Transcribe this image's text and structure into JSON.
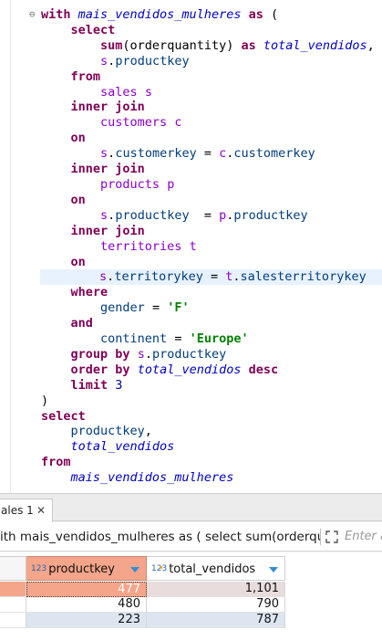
{
  "editor": {
    "lines": [
      [
        {
          "t": "with ",
          "c": "kw"
        },
        {
          "t": "mais_vendidos_mulheres",
          "c": "id"
        },
        {
          "t": " "
        },
        {
          "t": "as",
          "c": "kw"
        },
        {
          "t": " ("
        }
      ],
      [
        {
          "t": "    "
        },
        {
          "t": "select",
          "c": "kw"
        }
      ],
      [
        {
          "t": "        "
        },
        {
          "t": "sum",
          "c": "kw"
        },
        {
          "t": "(orderquantity) "
        },
        {
          "t": "as",
          "c": "kw"
        },
        {
          "t": " "
        },
        {
          "t": "total_vendidos",
          "c": "id"
        },
        {
          "t": ","
        }
      ],
      [
        {
          "t": "        "
        },
        {
          "t": "s",
          "c": "tb"
        },
        {
          "t": "."
        },
        {
          "t": "productkey",
          "c": "col"
        }
      ],
      [
        {
          "t": "    "
        },
        {
          "t": "from",
          "c": "kw"
        }
      ],
      [
        {
          "t": "        "
        },
        {
          "t": "sales",
          "c": "tb"
        },
        {
          "t": " "
        },
        {
          "t": "s",
          "c": "tb"
        }
      ],
      [
        {
          "t": "    "
        },
        {
          "t": "inner join",
          "c": "kw"
        }
      ],
      [
        {
          "t": "        "
        },
        {
          "t": "customers",
          "c": "tb"
        },
        {
          "t": " "
        },
        {
          "t": "c",
          "c": "tb"
        }
      ],
      [
        {
          "t": "    "
        },
        {
          "t": "on",
          "c": "kw"
        }
      ],
      [
        {
          "t": "        "
        },
        {
          "t": "s",
          "c": "tb"
        },
        {
          "t": "."
        },
        {
          "t": "customerkey",
          "c": "col"
        },
        {
          "t": " = "
        },
        {
          "t": "c",
          "c": "tb"
        },
        {
          "t": "."
        },
        {
          "t": "customerkey",
          "c": "col"
        }
      ],
      [
        {
          "t": "    "
        },
        {
          "t": "inner join",
          "c": "kw"
        }
      ],
      [
        {
          "t": "        "
        },
        {
          "t": "products",
          "c": "tb"
        },
        {
          "t": " "
        },
        {
          "t": "p",
          "c": "tb"
        }
      ],
      [
        {
          "t": "    "
        },
        {
          "t": "on",
          "c": "kw"
        }
      ],
      [
        {
          "t": "        "
        },
        {
          "t": "s",
          "c": "tb"
        },
        {
          "t": "."
        },
        {
          "t": "productkey",
          "c": "col"
        },
        {
          "t": "  = "
        },
        {
          "t": "p",
          "c": "tb"
        },
        {
          "t": "."
        },
        {
          "t": "productkey",
          "c": "col"
        }
      ],
      [
        {
          "t": "    "
        },
        {
          "t": "inner join",
          "c": "kw"
        }
      ],
      [
        {
          "t": "        "
        },
        {
          "t": "territories",
          "c": "tb"
        },
        {
          "t": " "
        },
        {
          "t": "t",
          "c": "tb"
        }
      ],
      [
        {
          "t": "    "
        },
        {
          "t": "on",
          "c": "kw"
        }
      ],
      [
        {
          "t": "        "
        },
        {
          "t": "s",
          "c": "tb"
        },
        {
          "t": "."
        },
        {
          "t": "territorykey",
          "c": "col"
        },
        {
          "t": " = "
        },
        {
          "t": "t",
          "c": "tb"
        },
        {
          "t": "."
        },
        {
          "t": "salesterritorykey",
          "c": "col"
        }
      ],
      [
        {
          "t": "    "
        },
        {
          "t": "where",
          "c": "kw"
        }
      ],
      [
        {
          "t": "        "
        },
        {
          "t": "gender",
          "c": "col"
        },
        {
          "t": " = "
        },
        {
          "t": "'F'",
          "c": "str"
        }
      ],
      [
        {
          "t": "    "
        },
        {
          "t": "and",
          "c": "kw"
        }
      ],
      [
        {
          "t": "        "
        },
        {
          "t": "continent",
          "c": "col"
        },
        {
          "t": " = "
        },
        {
          "t": "'Europe'",
          "c": "str"
        }
      ],
      [
        {
          "t": "    "
        },
        {
          "t": "group by",
          "c": "kw"
        },
        {
          "t": " "
        },
        {
          "t": "s",
          "c": "tb"
        },
        {
          "t": "."
        },
        {
          "t": "productkey",
          "c": "col"
        }
      ],
      [
        {
          "t": "    "
        },
        {
          "t": "order by",
          "c": "kw"
        },
        {
          "t": " "
        },
        {
          "t": "total_vendidos",
          "c": "id"
        },
        {
          "t": " "
        },
        {
          "t": "desc",
          "c": "kw"
        }
      ],
      [
        {
          "t": "    "
        },
        {
          "t": "limit",
          "c": "kw"
        },
        {
          "t": " "
        },
        {
          "t": "3",
          "c": "num"
        }
      ],
      [
        {
          "t": ")"
        }
      ],
      [
        {
          "t": "select",
          "c": "kw"
        }
      ],
      [
        {
          "t": "    "
        },
        {
          "t": "productkey",
          "c": "col"
        },
        {
          "t": ","
        }
      ],
      [
        {
          "t": "    "
        },
        {
          "t": "total_vendidos",
          "c": "id"
        }
      ],
      [
        {
          "t": "from",
          "c": "kw"
        }
      ],
      [
        {
          "t": "    "
        },
        {
          "t": "mais_vendidos_mulheres",
          "c": "id"
        }
      ]
    ],
    "highlighted_line": 17,
    "fold_marker": "⊖"
  },
  "results": {
    "tab_label": "ales 1",
    "tab_close": "✕",
    "query_text": "ith mais_vendidos_mulheres as ( select sum(orderqu",
    "filter_placeholder": "Enter a",
    "columns": [
      {
        "type_label": "123",
        "name": "productkey"
      },
      {
        "type_label": "123",
        "name": "total_vendidos"
      }
    ],
    "rows": [
      {
        "productkey": "477",
        "total_vendidos": "1,101"
      },
      {
        "productkey": "480",
        "total_vendidos": "790"
      },
      {
        "productkey": "223",
        "total_vendidos": "787"
      }
    ]
  },
  "colors": {
    "keyword": "#7f0055",
    "alias": "#0000c0",
    "table": "#8b00c8",
    "string": "#008000",
    "selected_header": "#f4a58a",
    "highlight_line": "#e8f2fe"
  }
}
